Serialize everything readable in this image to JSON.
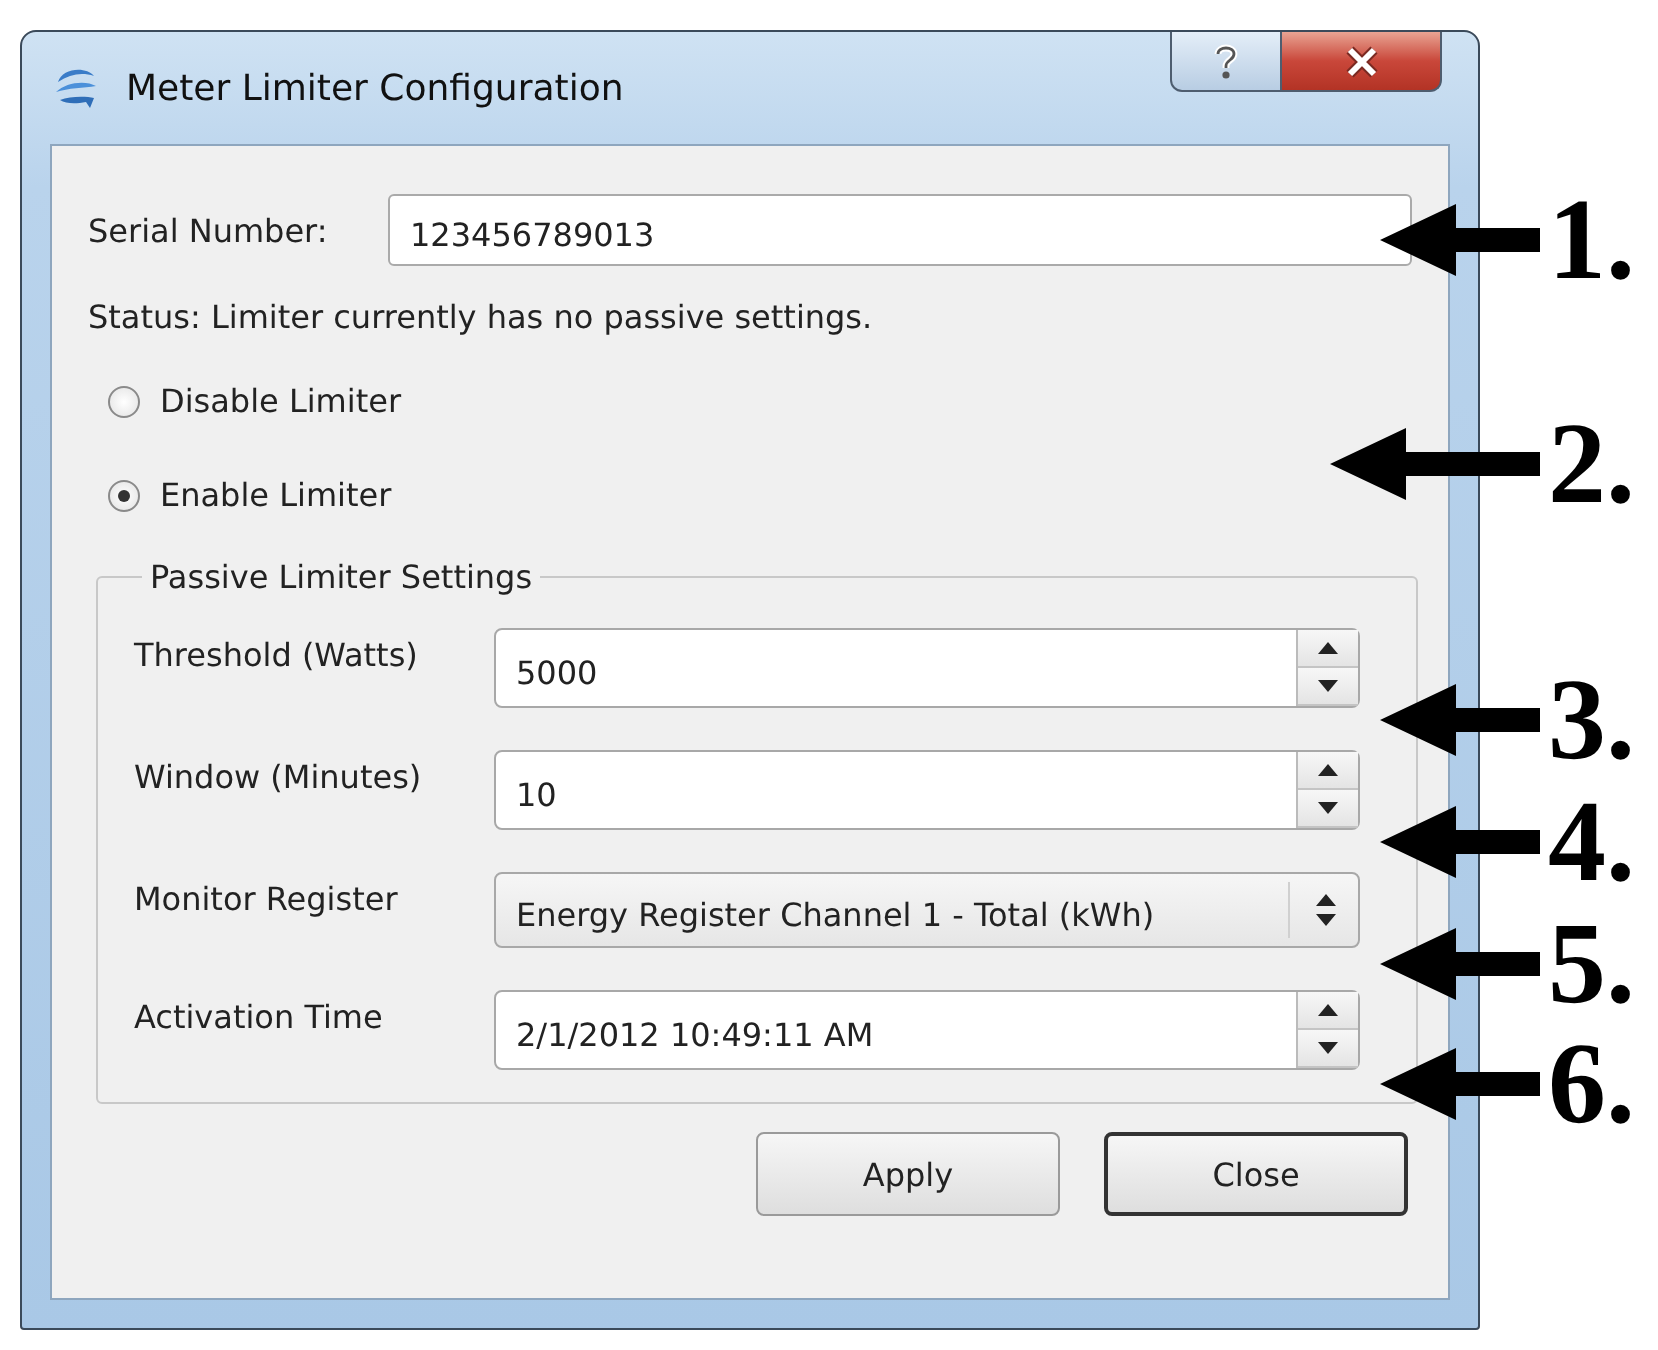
{
  "window": {
    "title": "Meter Limiter Configuration"
  },
  "serial_number": {
    "label": "Serial Number:",
    "value": "123456789013"
  },
  "status": "Status: Limiter currently has no passive settings.",
  "mode_options": [
    {
      "label": "Disable Limiter",
      "selected": false
    },
    {
      "label": "Enable Limiter",
      "selected": true
    }
  ],
  "group": {
    "title": "Passive Limiter Settings",
    "fields": [
      {
        "kind": "spinbox",
        "label": "Threshold (Watts)",
        "value": "5000"
      },
      {
        "kind": "spinbox",
        "label": "Window (Minutes)",
        "value": "10"
      },
      {
        "kind": "combobox",
        "label": "Monitor Register",
        "value": "Energy Register Channel 1 - Total (kWh)"
      },
      {
        "kind": "spinbox",
        "label": "Activation Time",
        "value": "2/1/2012 10:49:11 AM"
      }
    ]
  },
  "buttons": [
    {
      "label": "Apply",
      "default": false
    },
    {
      "label": "Close",
      "default": true
    }
  ],
  "callouts": [
    "1.",
    "2.",
    "3.",
    "4.",
    "5.",
    "6."
  ]
}
